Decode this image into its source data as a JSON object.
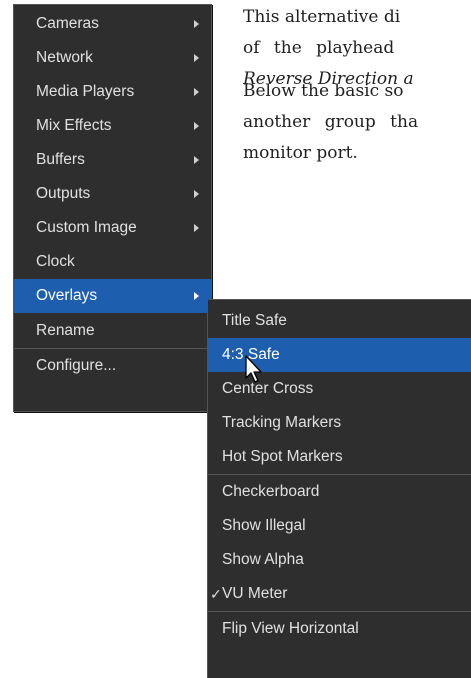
{
  "document": {
    "paragraph1": [
      "This alternative di",
      "of the playhead",
      "Reverse Direction a"
    ],
    "paragraph2": [
      "Below the basic so",
      "another group tha",
      "monitor port."
    ]
  },
  "main_menu": {
    "items": [
      {
        "label": "Cameras",
        "has_submenu": true
      },
      {
        "label": "Network",
        "has_submenu": true
      },
      {
        "label": "Media Players",
        "has_submenu": true
      },
      {
        "label": "Mix Effects",
        "has_submenu": true
      },
      {
        "label": "Buffers",
        "has_submenu": true
      },
      {
        "label": "Outputs",
        "has_submenu": true
      },
      {
        "label": "Custom Image",
        "has_submenu": true
      },
      {
        "label": "Clock",
        "has_submenu": false
      },
      {
        "label": "Overlays",
        "has_submenu": true,
        "selected": true
      },
      {
        "label": "Rename",
        "has_submenu": false
      },
      {
        "label": "Configure...",
        "has_submenu": false
      }
    ]
  },
  "overlays_submenu": {
    "items": [
      {
        "label": "Title Safe"
      },
      {
        "label": "4:3 Safe",
        "selected": true
      },
      {
        "label": "Center Cross"
      },
      {
        "label": "Tracking Markers"
      },
      {
        "label": "Hot Spot Markers"
      },
      {
        "label": "Checkerboard"
      },
      {
        "label": "Show Illegal"
      },
      {
        "label": "Show Alpha"
      },
      {
        "label": "VU Meter",
        "checked": true
      },
      {
        "label": "Flip View Horizontal"
      }
    ],
    "check_mark": "✓"
  },
  "colors": {
    "menu_background": "#2e2e2e",
    "highlight": "#1d5fae",
    "menu_text": "#e0e0e0"
  },
  "icons": {
    "submenu_arrow": "chevron-right-icon",
    "cursor": "mouse-pointer-icon",
    "check": "check-icon"
  }
}
